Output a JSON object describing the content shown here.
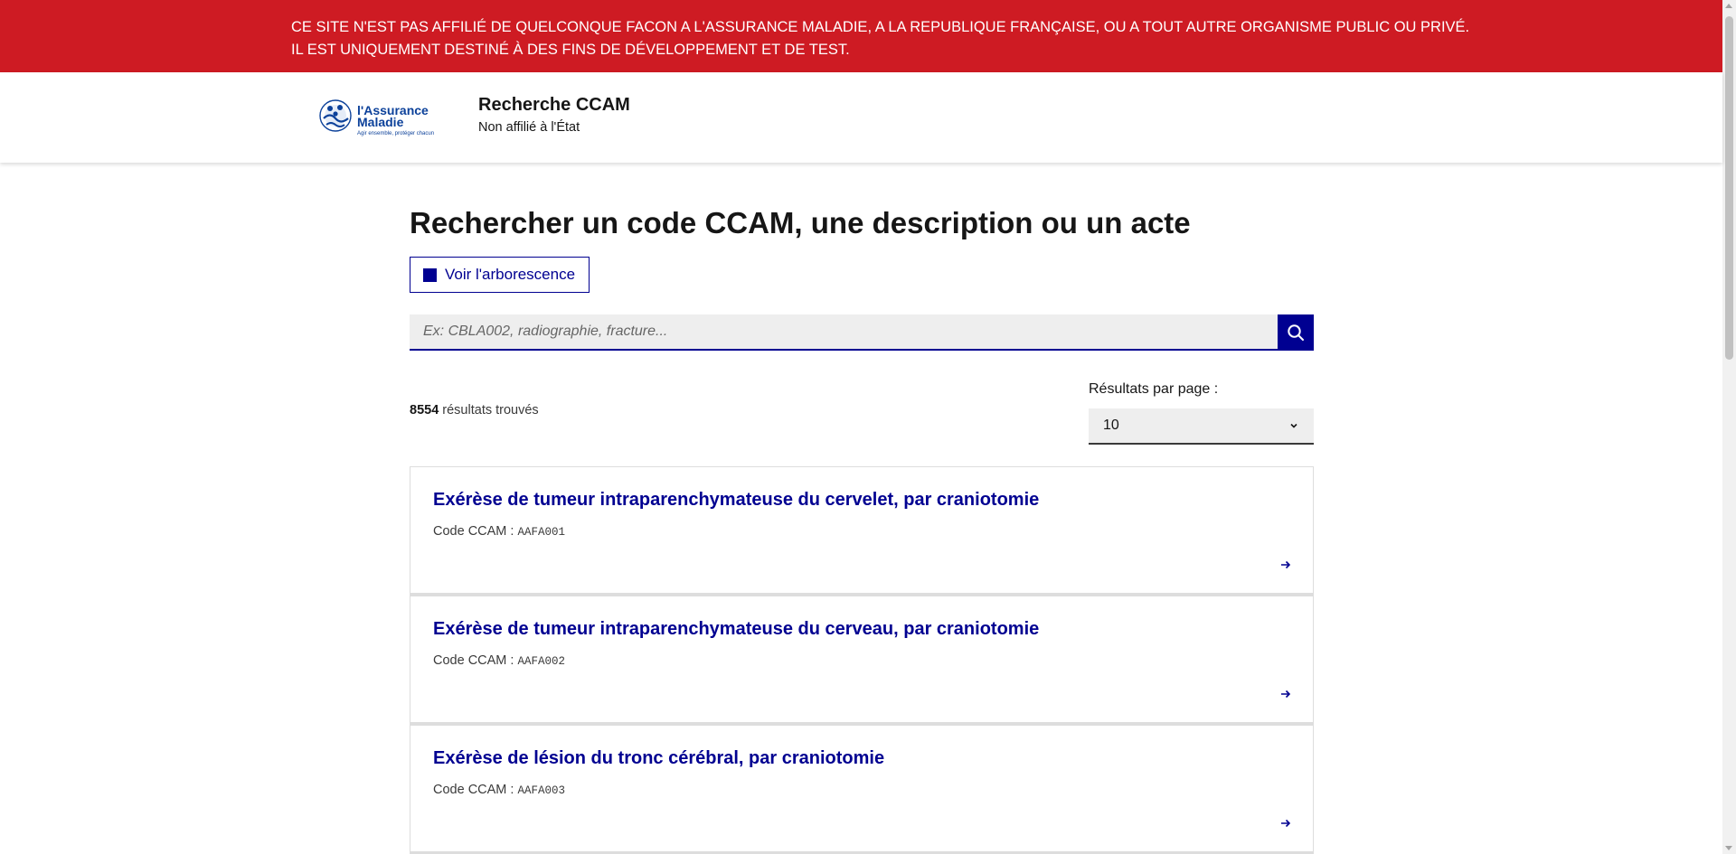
{
  "banner": {
    "line1": "CE SITE N'EST PAS AFFILIÉ DE QUELCONQUE FACON A L'ASSURANCE MALADIE, A LA REPUBLIQUE FRANÇAISE, OU A TOUT AUTRE ORGANISME PUBLIC OU PRIVÉ.",
    "line2": "IL EST UNIQUEMENT DESTINÉ À DES FINS DE DÉVELOPPEMENT ET DE TEST.",
    "background_color": "#ce1b23"
  },
  "header": {
    "logo": {
      "name_line1": "l'Assurance",
      "name_line2": "Maladie",
      "tagline": "Agir ensemble, protéger chacun"
    },
    "title": "Recherche CCAM",
    "subtitle": "Non affilié à l'État"
  },
  "main": {
    "heading": "Rechercher un code CCAM, une description ou un acte",
    "tree_button_label": "Voir l'arborescence",
    "search": {
      "value": "",
      "placeholder": "Ex: CBLA002, radiographie, fracture...",
      "button_icon": "search-icon"
    },
    "results_count": "8554",
    "results_count_suffix": " résultats trouvés",
    "per_page": {
      "label": "Résultats par page :",
      "selected": "10",
      "icon": "chevron-down-icon"
    },
    "code_label": "Code CCAM : ",
    "results": [
      {
        "title": "Exérèse de tumeur intraparenchymateuse du cervelet, par craniotomie",
        "code": "AAFA001"
      },
      {
        "title": "Exérèse de tumeur intraparenchymateuse du cerveau, par craniotomie",
        "code": "AAFA002"
      },
      {
        "title": "Exérèse de lésion du tronc cérébral, par craniotomie",
        "code": "AAFA003"
      }
    ]
  },
  "colors": {
    "primary": "#000091",
    "banner": "#ce1b23",
    "input_background": "#eeeeee"
  }
}
